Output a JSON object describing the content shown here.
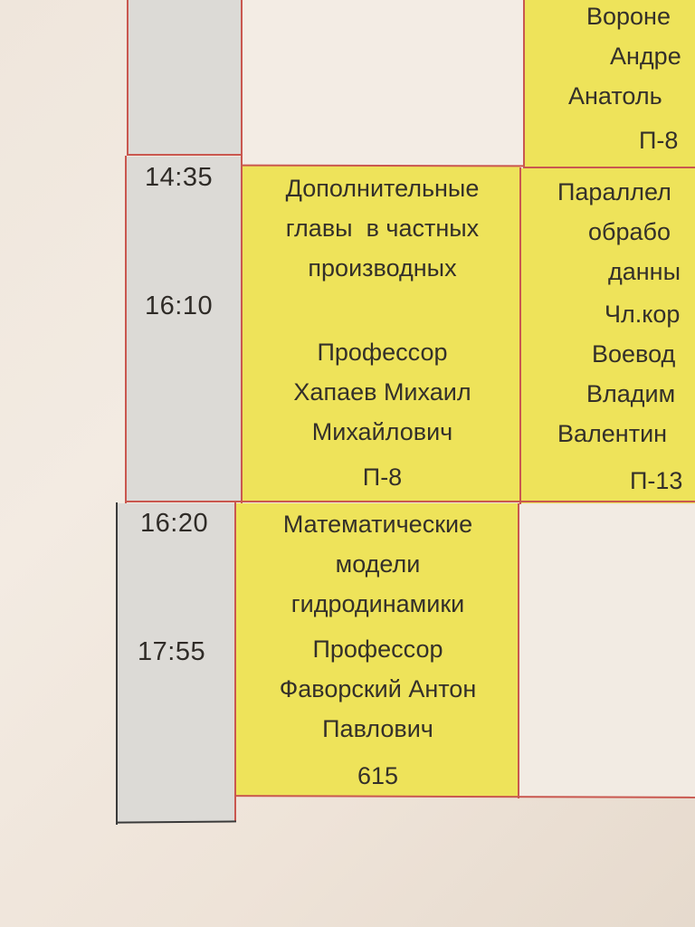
{
  "schedule": {
    "slot1": {
      "start": "14:35",
      "end": "16:10",
      "course": {
        "title_lines": [
          "Дополнительные",
          "главы  в частных",
          "производных"
        ],
        "teacher_lines": [
          "Профессор",
          "Хапаев Михаил",
          "Михайлович"
        ],
        "room": "П-8"
      },
      "right_course": {
        "title_lines": [
          "Параллел",
          "обрабо",
          "данны"
        ],
        "teacher_lines": [
          "Чл.кор",
          "Воевод",
          "Владим",
          "Валентин"
        ],
        "room": "П-13"
      }
    },
    "slot2": {
      "start": "16:20",
      "end": "17:55",
      "course": {
        "title_lines": [
          "Математические",
          "модели",
          "гидродинамики"
        ],
        "teacher_lines": [
          "Профессор",
          "Фаворский Антон",
          "Павлович"
        ],
        "room": "615"
      }
    },
    "top_right_course": {
      "teacher_lines": [
        "Вороне",
        "Андре",
        "Анатоль"
      ],
      "room": "П-8"
    }
  },
  "colors": {
    "grid_line": "#c9574f",
    "course_fill": "#eee35a",
    "time_fill": "#dcdad6"
  }
}
